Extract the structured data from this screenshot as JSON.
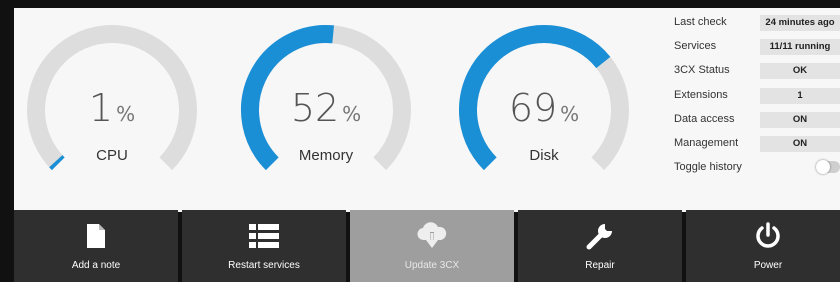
{
  "gauges": [
    {
      "value": "1",
      "percent": 1,
      "unit": "%",
      "label": "CPU"
    },
    {
      "value": "52",
      "percent": 52,
      "unit": "%",
      "label": "Memory"
    },
    {
      "value": "69",
      "percent": 69,
      "unit": "%",
      "label": "Disk"
    }
  ],
  "colors": {
    "accent": "#1b8fd6",
    "track": "#dddddd",
    "panel": "#f7f7f7",
    "button": "#2f2f2f",
    "button_disabled": "#9e9e9e"
  },
  "info": [
    {
      "label": "Last check",
      "value": "24 minutes ago"
    },
    {
      "label": "Services",
      "value": "11/11 running"
    },
    {
      "label": "3CX Status",
      "value": "OK"
    },
    {
      "label": "Extensions",
      "value": "1"
    },
    {
      "label": "Data access",
      "value": "ON"
    },
    {
      "label": "Management",
      "value": "ON"
    },
    {
      "label": "Toggle history",
      "toggle": false
    }
  ],
  "actions": [
    {
      "label": "Add a note",
      "icon": "file-icon",
      "enabled": true
    },
    {
      "label": "Restart services",
      "icon": "list-icon",
      "enabled": true
    },
    {
      "label": "Update 3CX",
      "icon": "cloud-download-icon",
      "enabled": false
    },
    {
      "label": "Repair",
      "icon": "wrench-icon",
      "enabled": true
    },
    {
      "label": "Power",
      "icon": "power-icon",
      "enabled": true
    }
  ]
}
